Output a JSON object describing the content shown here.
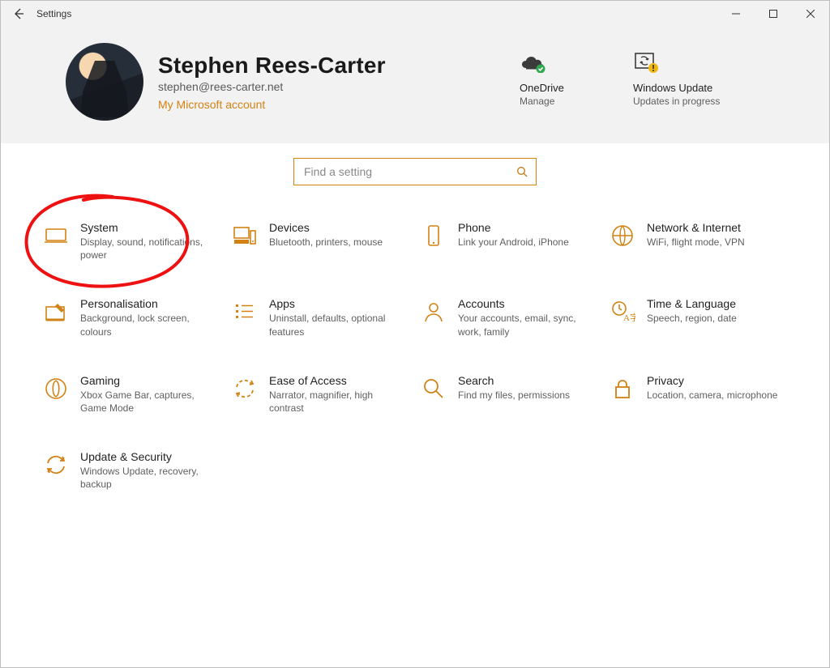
{
  "window": {
    "title": "Settings"
  },
  "colors": {
    "accent": "#d28214"
  },
  "user": {
    "name": "Stephen Rees-Carter",
    "email": "stephen@rees-carter.net",
    "account_link": "My Microsoft account"
  },
  "header_tiles": {
    "onedrive": {
      "label": "OneDrive",
      "sub": "Manage"
    },
    "update": {
      "label": "Windows Update",
      "sub": "Updates in progress"
    }
  },
  "search": {
    "placeholder": "Find a setting"
  },
  "categories": [
    {
      "key": "system",
      "title": "System",
      "desc": "Display, sound, notifications, power"
    },
    {
      "key": "devices",
      "title": "Devices",
      "desc": "Bluetooth, printers, mouse"
    },
    {
      "key": "phone",
      "title": "Phone",
      "desc": "Link your Android, iPhone"
    },
    {
      "key": "network",
      "title": "Network & Internet",
      "desc": "WiFi, flight mode, VPN"
    },
    {
      "key": "personalisation",
      "title": "Personalisation",
      "desc": "Background, lock screen, colours"
    },
    {
      "key": "apps",
      "title": "Apps",
      "desc": "Uninstall, defaults, optional features"
    },
    {
      "key": "accounts",
      "title": "Accounts",
      "desc": "Your accounts, email, sync, work, family"
    },
    {
      "key": "time",
      "title": "Time & Language",
      "desc": "Speech, region, date"
    },
    {
      "key": "gaming",
      "title": "Gaming",
      "desc": "Xbox Game Bar, captures, Game Mode"
    },
    {
      "key": "ease",
      "title": "Ease of Access",
      "desc": "Narrator, magnifier, high contrast"
    },
    {
      "key": "search",
      "title": "Search",
      "desc": "Find my files, permissions"
    },
    {
      "key": "privacy",
      "title": "Privacy",
      "desc": "Location, camera, microphone"
    },
    {
      "key": "update-sec",
      "title": "Update & Security",
      "desc": "Windows Update, recovery, backup"
    }
  ],
  "annotation": {
    "circled_category": "system"
  }
}
